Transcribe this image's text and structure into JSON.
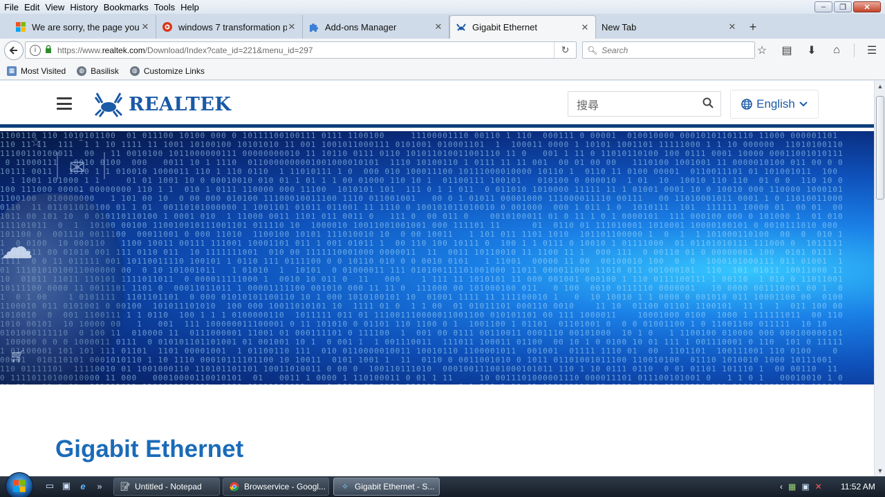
{
  "menubar": {
    "items": [
      "File",
      "Edit",
      "View",
      "History",
      "Bookmarks",
      "Tools",
      "Help"
    ]
  },
  "tabs": [
    {
      "title": "We are sorry, the page you r",
      "icon": "windows-logo-icon"
    },
    {
      "title": "windows 7 transformation p",
      "icon": "red-circle-icon"
    },
    {
      "title": "Add-ons Manager",
      "icon": "puzzle-icon"
    },
    {
      "title": "Gigabit Ethernet",
      "icon": "realtek-crab-icon",
      "active": true
    },
    {
      "title": "New Tab",
      "icon": ""
    }
  ],
  "navbar": {
    "url_prefix": "https://www.",
    "url_domain": "realtek.com",
    "url_path": "/Download/Index?cate_id=221&menu_id=297",
    "search_placeholder": "Search"
  },
  "bookmarks": [
    {
      "label": "Most Visited",
      "icon": "bookmark-folder-icon"
    },
    {
      "label": "Basilisk",
      "icon": "globe-icon"
    },
    {
      "label": "Customize Links",
      "icon": "globe-icon"
    }
  ],
  "site": {
    "logo_text": "REALTEK",
    "search_placeholder": "搜尋",
    "language": "English",
    "page_title": "Gigabit Ethernet",
    "accent": "#1a6bb8",
    "header_border": "#0b3f7a"
  },
  "taskbar": {
    "items": [
      {
        "label": "Untitled - Notepad",
        "icon": "notepad-icon"
      },
      {
        "label": "Browservice - Googl...",
        "icon": "chrome-icon"
      },
      {
        "label": "Gigabit Ethernet - S...",
        "icon": "realtek-crab-icon",
        "active": true
      }
    ],
    "clock": "11:52 AM"
  }
}
